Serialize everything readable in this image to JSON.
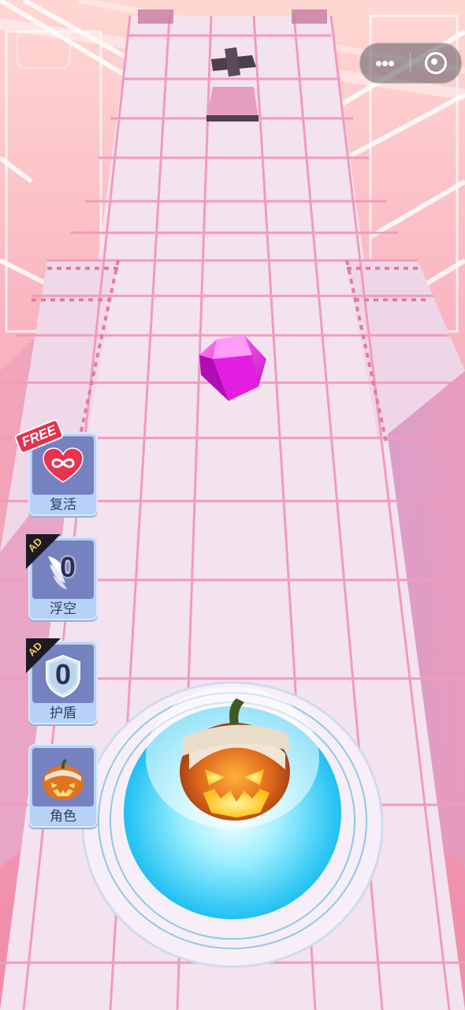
{
  "side_buttons": [
    {
      "label": "复活",
      "badge": "FREE",
      "icon": "infinity-heart-icon"
    },
    {
      "label": "浮空",
      "badge": "AD",
      "icon": "wing-icon",
      "count": "0"
    },
    {
      "label": "护盾",
      "badge": "AD",
      "icon": "shield-icon",
      "count": "0"
    },
    {
      "label": "角色",
      "icon": "pumpkin-character-icon"
    }
  ],
  "top_bar": {
    "menu_icon": "more-dots-icon",
    "close_icon": "target-close-icon",
    "back_icon": "back-icon"
  },
  "game": {
    "collectible": "gem",
    "gem_color": "#e11fe0",
    "player": "mummy-pumpkin",
    "track_color": "#f3e3ee",
    "grid_color": "#f19bbd"
  }
}
